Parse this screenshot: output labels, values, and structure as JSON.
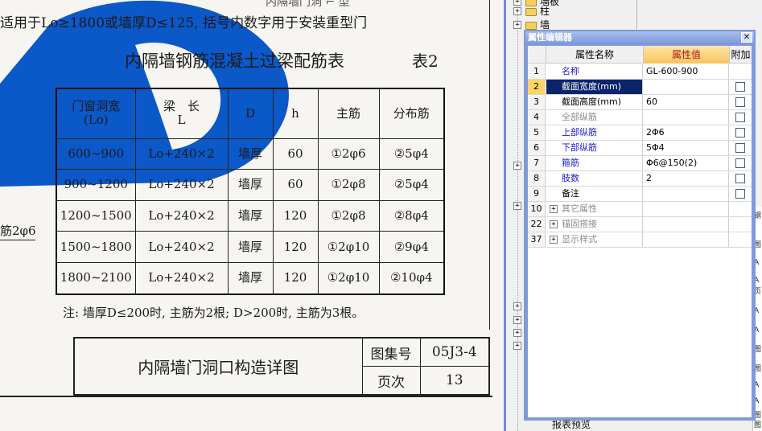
{
  "document": {
    "top_fragment": "内隔墙门洞 ⌐ 型",
    "top_note": "适用于Lo≥1800或墙厚D≤125, 括号内数字用于安装重型门",
    "side_fragment": "筋2φ6",
    "table_title": "内隔墙钢筋混凝土过梁配筋表",
    "table_no": "表2",
    "table": {
      "headers": [
        "门窗洞宽\n(Lo)",
        "梁　长\nL",
        "D",
        "h",
        "主筋",
        "分布筋"
      ],
      "rows": [
        [
          "600~900",
          "Lo+240×2",
          "墙厚",
          "60",
          "①2φ6",
          "②5φ4"
        ],
        [
          "900~1200",
          "Lo+240×2",
          "墙厚",
          "60",
          "①2φ8",
          "②5φ4"
        ],
        [
          "1200~1500",
          "Lo+240×2",
          "墙厚",
          "120",
          "①2φ8",
          "②8φ4"
        ],
        [
          "1500~1800",
          "Lo+240×2",
          "墙厚",
          "120",
          "①2φ10",
          "②9φ4"
        ],
        [
          "1800~2100",
          "Lo+240×2",
          "墙厚",
          "120",
          "①2φ10",
          "②10φ4"
        ]
      ]
    },
    "note": "注: 墙厚D≤200时, 主筋为2根; D>200时, 主筋为3根。",
    "titleblock": {
      "drawing_title": "内隔墙门洞口构造详图",
      "atlas_label": "图集号",
      "atlas_value": "05J3-4",
      "page_label": "页次",
      "page_value": "13"
    }
  },
  "tree": {
    "items": [
      {
        "label": "墙板",
        "expander": "+"
      },
      {
        "label": "柱",
        "expander": "+"
      },
      {
        "label": "墙",
        "expander": "+"
      }
    ],
    "bottom_label": "报表预览"
  },
  "property_editor": {
    "title": "属性编辑器",
    "close_glyph": "✕",
    "columns": [
      "属性名称",
      "属性值",
      "附加"
    ],
    "rows": [
      {
        "num": "1",
        "name": "名称",
        "value": "GL-600-900",
        "name_color": "blue",
        "checkbox": false,
        "selected": false
      },
      {
        "num": "2",
        "name": "截面宽度(mm)",
        "value": "",
        "name_color": "black",
        "checkbox": true,
        "selected": true
      },
      {
        "num": "3",
        "name": "截面高度(mm)",
        "value": "60",
        "name_color": "black",
        "checkbox": true,
        "selected": false
      },
      {
        "num": "4",
        "name": "全部纵筋",
        "value": "",
        "name_color": "gray",
        "checkbox": true,
        "selected": false
      },
      {
        "num": "5",
        "name": "上部纵筋",
        "value": "2Φ6",
        "name_color": "blue",
        "checkbox": true,
        "selected": false
      },
      {
        "num": "6",
        "name": "下部纵筋",
        "value": "5Φ4",
        "name_color": "blue",
        "checkbox": true,
        "selected": false
      },
      {
        "num": "7",
        "name": "箍筋",
        "value": "Φ6@150(2)",
        "name_color": "blue",
        "checkbox": true,
        "selected": false
      },
      {
        "num": "8",
        "name": "肢数",
        "value": "2",
        "name_color": "blue",
        "checkbox": true,
        "selected": false
      },
      {
        "num": "9",
        "name": "备注",
        "value": "",
        "name_color": "black",
        "checkbox": true,
        "selected": false
      },
      {
        "num": "10",
        "name": "其它属性",
        "value": "",
        "name_color": "gray",
        "checkbox": false,
        "selected": false,
        "expander": "+"
      },
      {
        "num": "22",
        "name": "锚固搭接",
        "value": "",
        "name_color": "gray",
        "checkbox": false,
        "selected": false,
        "expander": "+"
      },
      {
        "num": "37",
        "name": "显示样式",
        "value": "",
        "name_color": "gray",
        "checkbox": false,
        "selected": false,
        "expander": "+"
      }
    ]
  },
  "right_strip": [
    "钢",
    "图",
    "A",
    "A",
    "页",
    "A",
    "A",
    "图",
    "图",
    "A",
    "A",
    "图",
    "图"
  ],
  "colors": {
    "accent_blue": "#0b58c8",
    "window_border": "#7e98d8",
    "selection": "#0a246a",
    "value_header": "#f7c35a"
  }
}
